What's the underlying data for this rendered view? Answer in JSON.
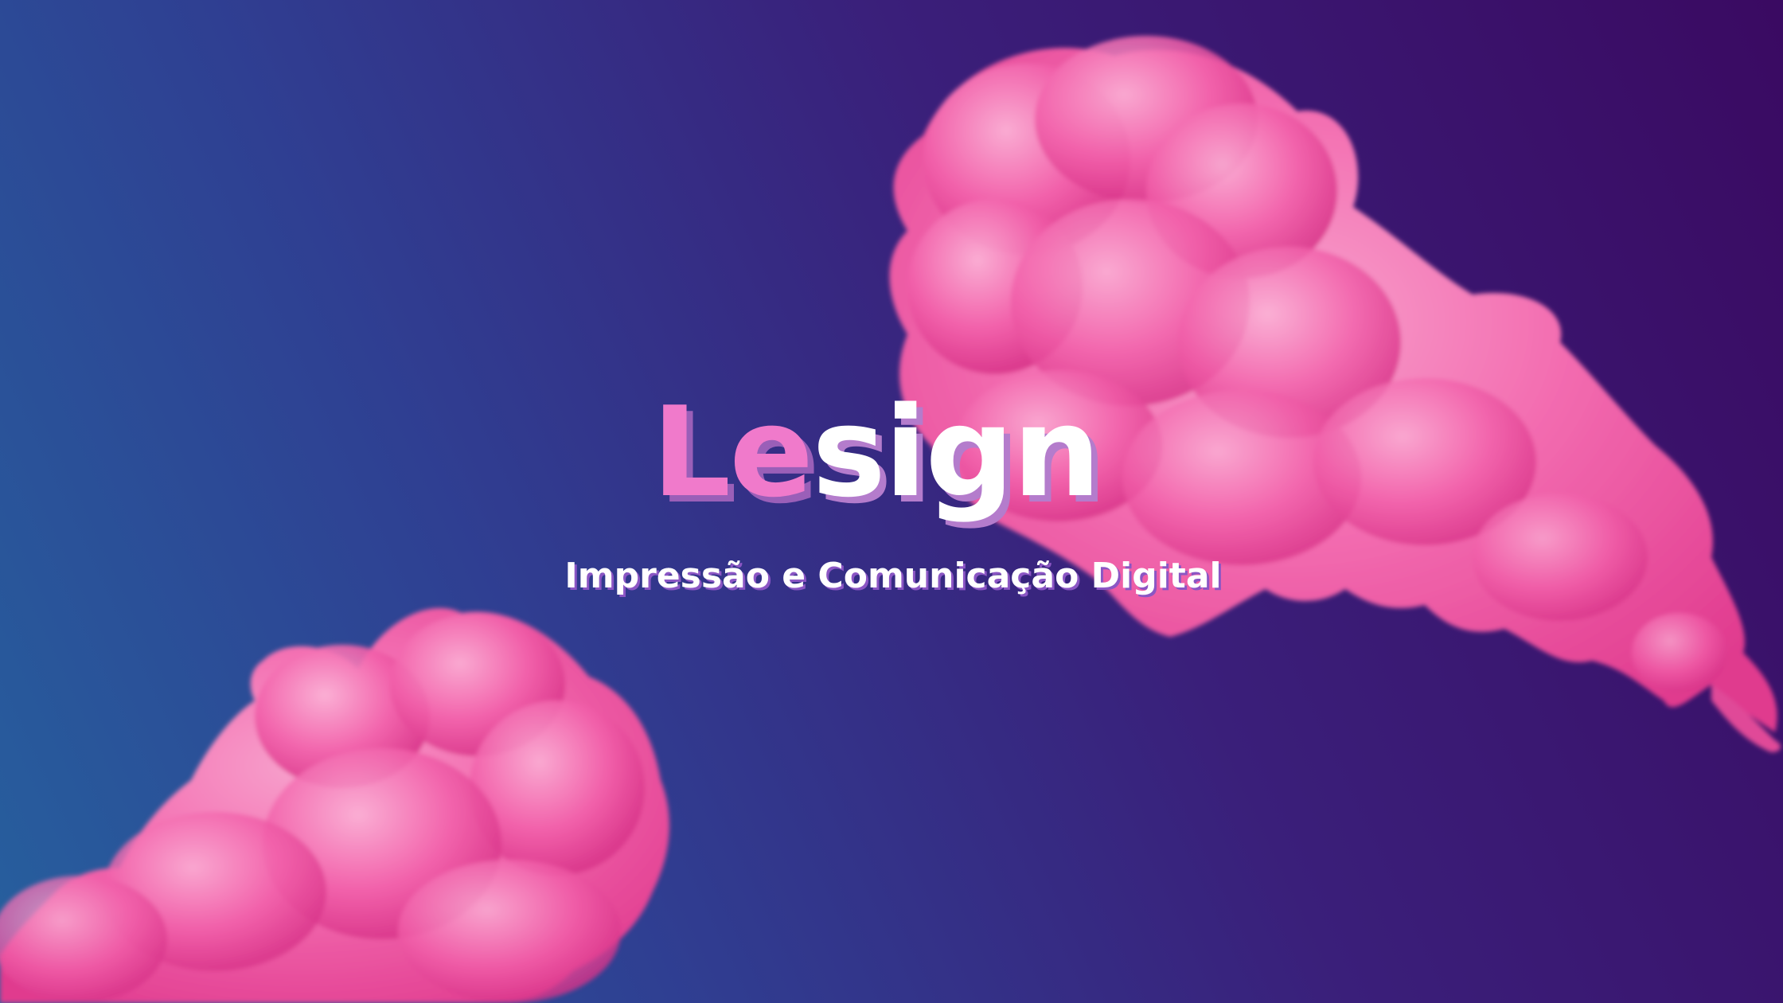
{
  "logo": {
    "accent_text": "Le",
    "rest_text": "sign"
  },
  "tagline": "Impressão e Comunicação Digital",
  "colors": {
    "background_left": "#26609e",
    "background_right": "#3a0a62",
    "smoke_pink": "#f0509f",
    "logo_accent": "#f07acb",
    "logo_shadow": "#9a5fb8",
    "text_white": "#ffffff"
  }
}
